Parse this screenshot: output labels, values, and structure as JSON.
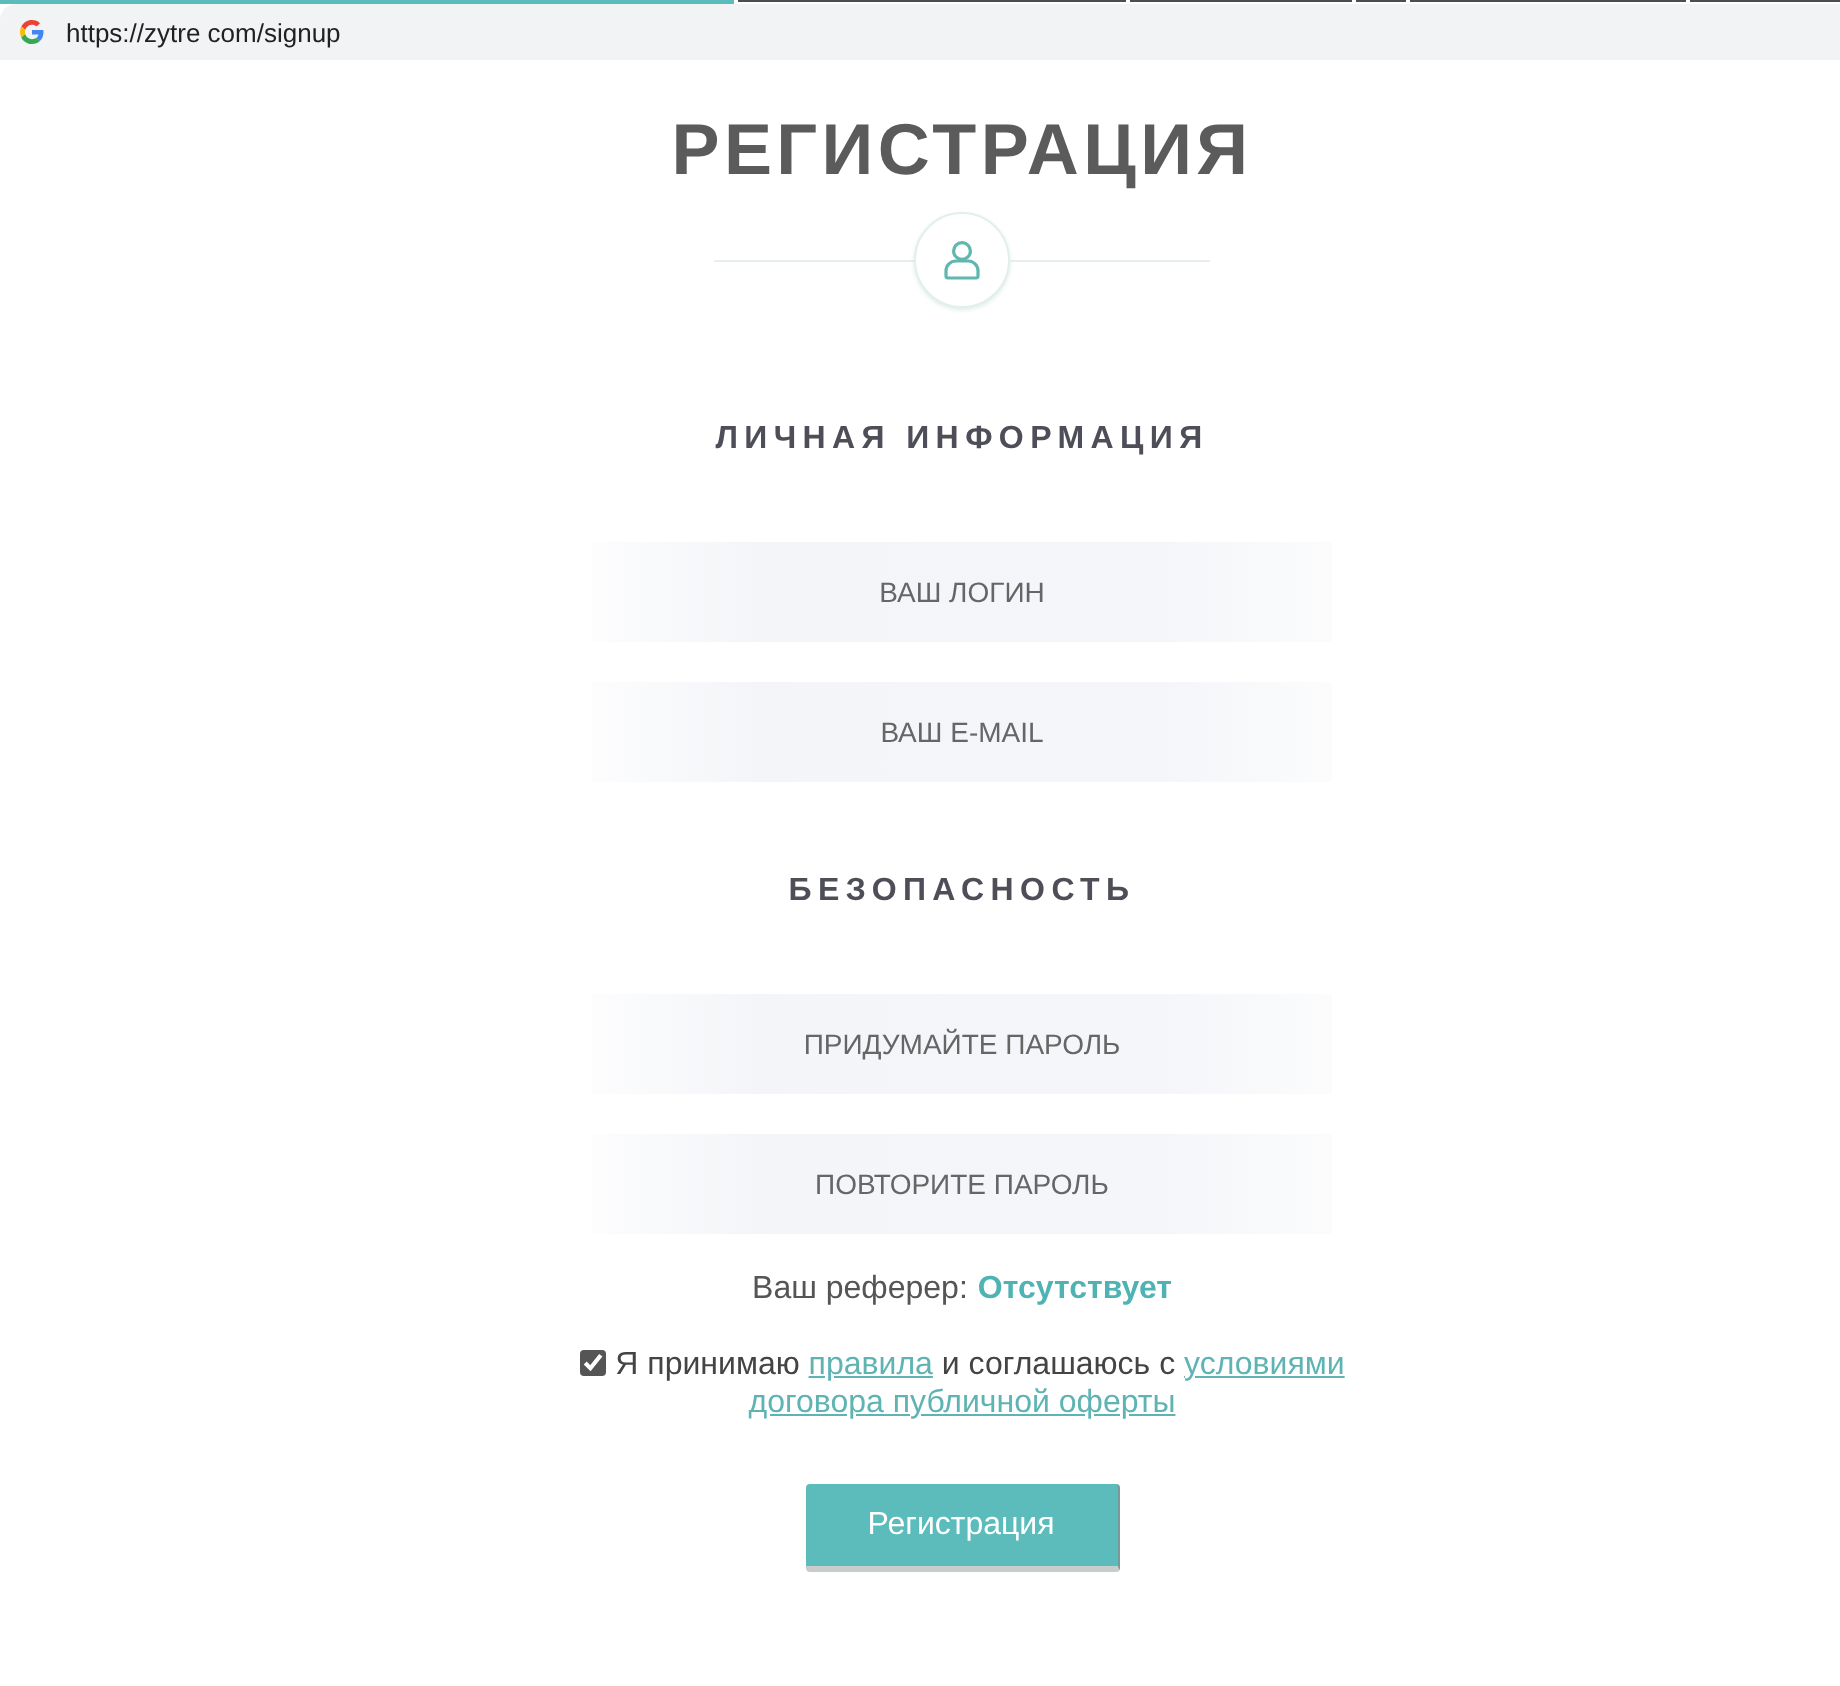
{
  "browser": {
    "url": "https://zytre com/signup"
  },
  "page": {
    "title": "РЕГИСТРАЦИЯ"
  },
  "sections": [
    {
      "heading": "ЛИЧНАЯ ИНФОРМАЦИЯ",
      "fields": [
        {
          "placeholder": "ВАШ ЛОГИН"
        },
        {
          "placeholder": "ВАШ E-MAIL"
        }
      ]
    },
    {
      "heading": "БЕЗОПАСНОСТЬ",
      "fields": [
        {
          "placeholder": "ПРИДУМАЙТЕ ПАРОЛЬ"
        },
        {
          "placeholder": "ПОВТОРИТЕ ПАРОЛЬ"
        }
      ]
    }
  ],
  "referrer": {
    "label": "Ваш реферер:",
    "value": "Отсутствует"
  },
  "agreement": {
    "checked": true,
    "parts": [
      {
        "kind": "text",
        "text": "Я принимаю"
      },
      {
        "kind": "link",
        "text": "правила"
      },
      {
        "kind": "text",
        "text": "и соглашаюсь с"
      },
      {
        "kind": "link",
        "text": "условиями"
      },
      {
        "kind": "link",
        "text": "договора публичной оферты"
      }
    ]
  },
  "submit_button": {
    "label": "Регистрация"
  }
}
